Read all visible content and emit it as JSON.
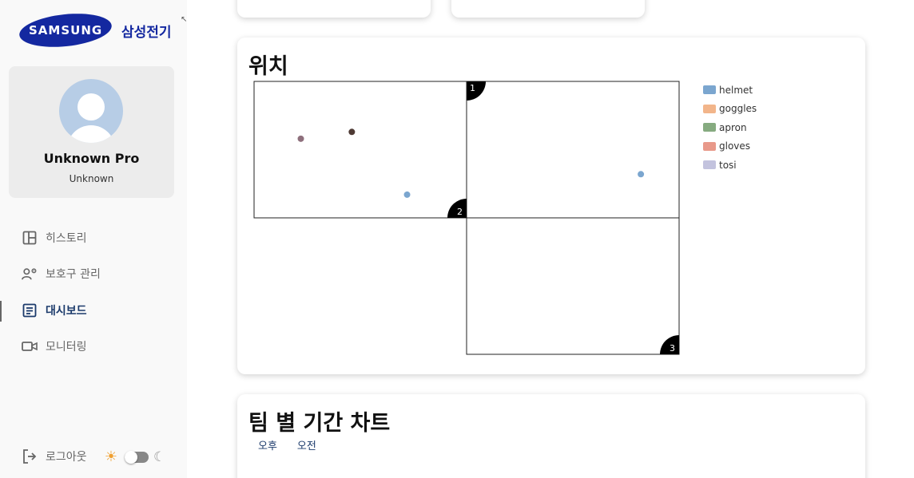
{
  "brand": {
    "logo_text": "SAMSUNG",
    "name_kr": "삼성전기"
  },
  "profile": {
    "name": "Unknown Pro",
    "role": "Unknown"
  },
  "nav": {
    "history": "히스토리",
    "equipment": "보호구 관리",
    "dashboard": "대시보드",
    "monitoring": "모니터링",
    "active": "dashboard"
  },
  "logout_label": "로그아웃",
  "theme": {
    "mode": "light"
  },
  "position_card": {
    "title": "위치",
    "chart_data": {
      "type": "scatter",
      "title": "위치",
      "zones": [
        {
          "id": "1",
          "label": "1"
        },
        {
          "id": "2",
          "label": "2"
        },
        {
          "id": "3",
          "label": "3"
        }
      ],
      "series": [
        {
          "name": "helmet",
          "color": "#7ba6cf"
        },
        {
          "name": "goggles",
          "color": "#f2b58a"
        },
        {
          "name": "apron",
          "color": "#86ab80"
        },
        {
          "name": "gloves",
          "color": "#e8998a"
        },
        {
          "name": "tosi",
          "color": "#c3c3de"
        }
      ],
      "points": [
        {
          "x": 0.22,
          "y": 0.42,
          "color": "#8e6f7c"
        },
        {
          "x": 0.46,
          "y": 0.37,
          "color": "#4e3a34"
        },
        {
          "x": 0.72,
          "y": 0.83,
          "color": "#7ba6cf"
        },
        {
          "x": 1.82,
          "y": 0.68,
          "color": "#7ba6cf"
        }
      ]
    }
  },
  "team_card": {
    "title": "팀 별 기간 차트",
    "tabs": [
      "오후",
      "오전"
    ]
  }
}
